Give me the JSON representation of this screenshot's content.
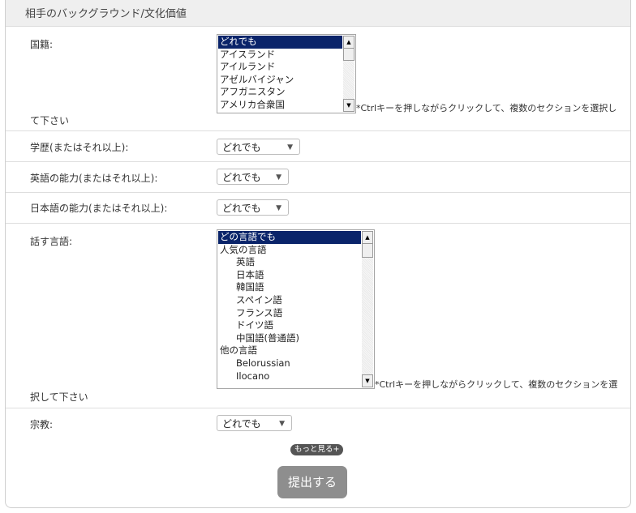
{
  "section": {
    "title": "相手のバックグラウンド/文化価値"
  },
  "nationality": {
    "label": "国籍:",
    "options": [
      "どれでも",
      "アイスランド",
      "アイルランド",
      "アゼルバイジャン",
      "アフガニスタン",
      "アメリカ合衆国"
    ],
    "selected": "どれでも",
    "note": "*Ctrlキーを押しながらクリックして、複数のセクションを選択し",
    "note_tail": "て下さい"
  },
  "education": {
    "label": "学歴(またはそれ以上):",
    "value": "どれでも"
  },
  "english": {
    "label": "英語の能力(またはそれ以上):",
    "value": "どれでも"
  },
  "japanese": {
    "label": "日本語の能力(またはそれ以上):",
    "value": "どれでも"
  },
  "languages": {
    "label": "話す言語:",
    "options": [
      {
        "text": "どの言語でも",
        "selected": true,
        "indent": false
      },
      {
        "text": "人気の言語",
        "selected": false,
        "indent": false
      },
      {
        "text": "英語",
        "selected": false,
        "indent": true
      },
      {
        "text": "日本語",
        "selected": false,
        "indent": true
      },
      {
        "text": "韓国語",
        "selected": false,
        "indent": true
      },
      {
        "text": "スペイン語",
        "selected": false,
        "indent": true
      },
      {
        "text": "フランス語",
        "selected": false,
        "indent": true
      },
      {
        "text": "ドイツ語",
        "selected": false,
        "indent": true
      },
      {
        "text": "中国語(普通語)",
        "selected": false,
        "indent": true
      },
      {
        "text": "他の言語",
        "selected": false,
        "indent": false
      },
      {
        "text": "Belorussian",
        "selected": false,
        "indent": true
      },
      {
        "text": "Ilocano",
        "selected": false,
        "indent": true
      }
    ],
    "note": "*Ctrlキーを押しながらクリックして、複数のセクションを選",
    "note_tail": "択して下さい"
  },
  "religion": {
    "label": "宗教:",
    "value": "どれでも"
  },
  "more_label": "もっと見る+",
  "submit_label": "提出する",
  "icons": {
    "scroll_up": "scroll-up-arrow-icon",
    "scroll_down": "scroll-down-arrow-icon",
    "dropdown": "chevron-down-icon"
  }
}
